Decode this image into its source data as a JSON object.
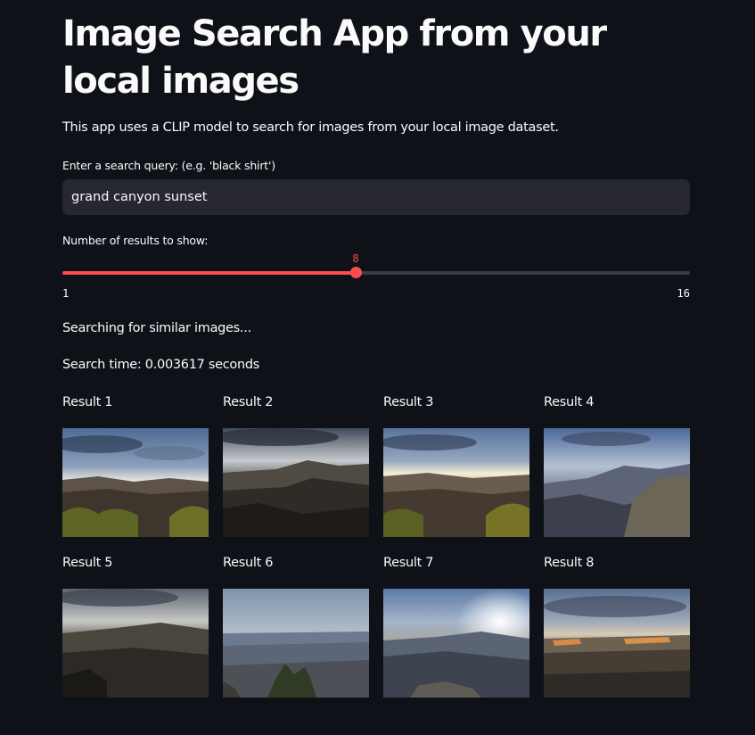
{
  "app": {
    "title": "Image Search App from your local images",
    "description": "This app uses a CLIP model to search for images from your local image dataset."
  },
  "search": {
    "label": "Enter a search query: (e.g. 'black shirt')",
    "value": "grand canyon sunset"
  },
  "slider": {
    "label": "Number of results to show:",
    "value": 8,
    "min": 1,
    "max": 16,
    "accent": "#ff4b4b"
  },
  "status": {
    "searching": "Searching for similar images...",
    "time": "Search time: 0.003617 seconds"
  },
  "results": [
    {
      "label": "Result 1"
    },
    {
      "label": "Result 2"
    },
    {
      "label": "Result 3"
    },
    {
      "label": "Result 4"
    },
    {
      "label": "Result 5"
    },
    {
      "label": "Result 6"
    },
    {
      "label": "Result 7"
    },
    {
      "label": "Result 8"
    }
  ]
}
